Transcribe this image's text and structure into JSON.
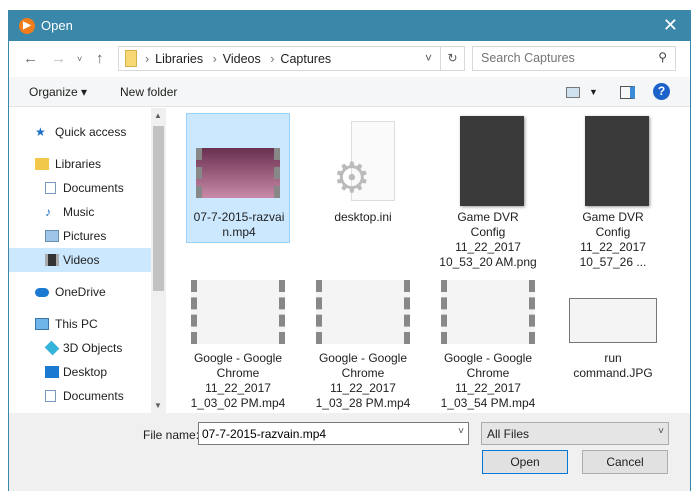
{
  "title": "Open",
  "nav": {
    "path": [
      "Libraries",
      "Videos",
      "Captures"
    ],
    "search_placeholder": "Search Captures"
  },
  "toolbar": {
    "organize": "Organize",
    "new_folder": "New folder"
  },
  "sidebar": [
    {
      "label": "Quick access",
      "icon": "star-icon"
    },
    {
      "label": "Libraries",
      "icon": "libraries-icon"
    },
    {
      "label": "Documents",
      "icon": "documents-icon"
    },
    {
      "label": "Music",
      "icon": "music-icon"
    },
    {
      "label": "Pictures",
      "icon": "pictures-icon"
    },
    {
      "label": "Videos",
      "icon": "videos-icon",
      "selected": true
    },
    {
      "label": "OneDrive",
      "icon": "cloud-icon"
    },
    {
      "label": "This PC",
      "icon": "computer-icon"
    },
    {
      "label": "3D Objects",
      "icon": "cube-icon"
    },
    {
      "label": "Desktop",
      "icon": "desktop-icon"
    },
    {
      "label": "Documents",
      "icon": "documents-icon"
    }
  ],
  "files": [
    {
      "name": "07-7-2015-razvai\nn.mp4",
      "type": "video"
    },
    {
      "name": "desktop.ini",
      "type": "ini"
    },
    {
      "name": "Game DVR\nConfig\n11_22_2017\n10_53_20 AM.png",
      "type": "image"
    },
    {
      "name": "Game DVR\nConfig\n11_22_2017\n10_57_26 ...",
      "type": "image"
    },
    {
      "name": "Google - Google\nChrome\n11_22_2017\n1_03_02 PM.mp4",
      "type": "video"
    },
    {
      "name": "Google - Google\nChrome\n11_22_2017\n1_03_28 PM.mp4",
      "type": "video"
    },
    {
      "name": "Google - Google\nChrome\n11_22_2017\n1_03_54 PM.mp4",
      "type": "video"
    },
    {
      "name": "run\ncommand.JPG",
      "type": "image"
    }
  ],
  "bottom": {
    "file_name_label": "File name:",
    "file_name_value": "07-7-2015-razvain.mp4",
    "filter": "All Files",
    "open": "Open",
    "cancel": "Cancel"
  }
}
